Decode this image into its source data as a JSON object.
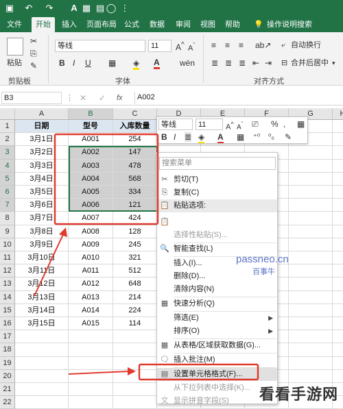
{
  "tabs": [
    "文件",
    "开始",
    "插入",
    "页面布局",
    "公式",
    "数据",
    "审阅",
    "视图",
    "帮助"
  ],
  "tell_me": "操作说明搜索",
  "ribbon": {
    "paste": "粘贴",
    "clipboard": "剪贴板",
    "font_group": "字体",
    "align_group": "对齐方式",
    "font_name": "等线",
    "font_size": "11",
    "wrap": "自动换行",
    "merge": "合并后居中"
  },
  "formula_bar": {
    "name_box": "B3",
    "fx": "fx",
    "value": "A002"
  },
  "columns": [
    "A",
    "B",
    "C",
    "D",
    "E",
    "F",
    "G",
    "H"
  ],
  "rows": [
    "1",
    "2",
    "3",
    "4",
    "5",
    "6",
    "7",
    "8",
    "9",
    "10",
    "11",
    "12",
    "13",
    "14",
    "15",
    "16",
    "17",
    "18",
    "19",
    "20",
    "21",
    "22"
  ],
  "headers": [
    "日期",
    "型号",
    "入库数量"
  ],
  "data": [
    [
      "3月1日",
      "A001",
      "254"
    ],
    [
      "3月2日",
      "A002",
      "147"
    ],
    [
      "3月3日",
      "A003",
      "478"
    ],
    [
      "3月4日",
      "A004",
      "568"
    ],
    [
      "3月5日",
      "A005",
      "334"
    ],
    [
      "3月6日",
      "A006",
      "121"
    ],
    [
      "3月7日",
      "A007",
      "424"
    ],
    [
      "3月8日",
      "A008",
      "128"
    ],
    [
      "3月9日",
      "A009",
      "245"
    ],
    [
      "3月10日",
      "A010",
      "321"
    ],
    [
      "3月11日",
      "A011",
      "512"
    ],
    [
      "3月12日",
      "A012",
      "648"
    ],
    [
      "3月13日",
      "A013",
      "214"
    ],
    [
      "3月14日",
      "A014",
      "224"
    ],
    [
      "3月15日",
      "A015",
      "114"
    ]
  ],
  "mini_toolbar": {
    "font": "等线",
    "size": "11",
    "percent": "%",
    "comma": ","
  },
  "context_menu": {
    "search_placeholder": "搜索菜单",
    "items": [
      "剪切(T)",
      "复制(C)",
      "粘贴选项:",
      "选择性粘贴(S)...",
      "智能查找(L)",
      "插入(I)...",
      "删除(D)...",
      "清除内容(N)",
      "快速分析(Q)",
      "筛选(E)",
      "排序(O)",
      "从表格/区域获取数据(G)...",
      "插入批注(M)",
      "设置单元格格式(F)...",
      "从下拉列表中选择(K)...",
      "显示拼音字段(S)"
    ]
  },
  "watermark": {
    "site": "passneo.cn",
    "brand": "百事牛",
    "logo": "看看手游网"
  },
  "colors": {
    "accent": "#217346",
    "highlight": "#e03a2f"
  }
}
